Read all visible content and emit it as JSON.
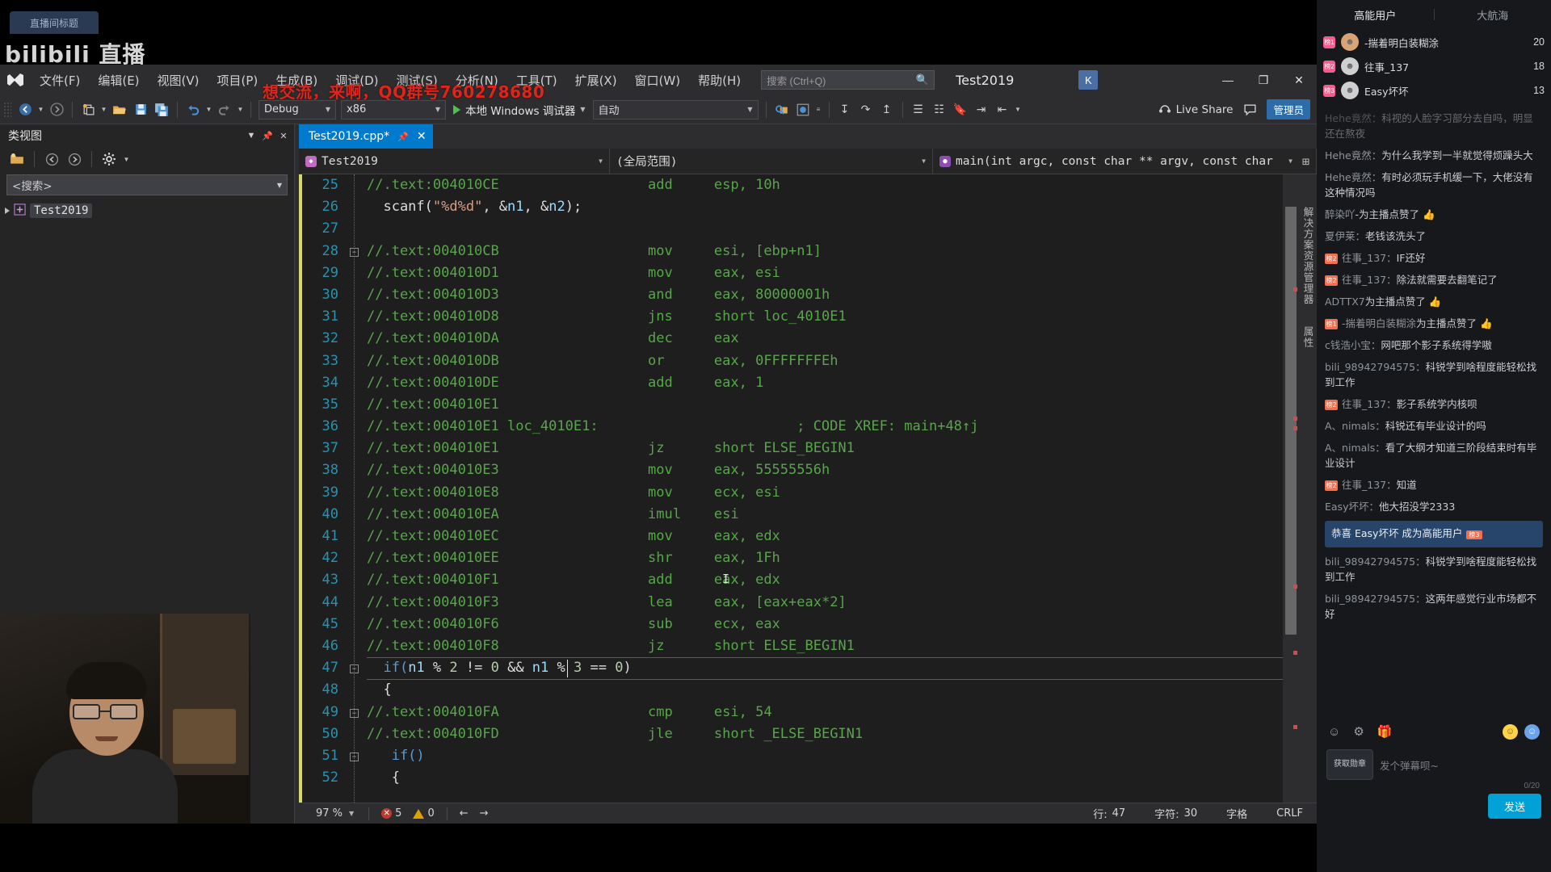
{
  "stream": {
    "tab_label": "直播间标题",
    "logo_text": "bilibili 直播"
  },
  "vs": {
    "window_title": "Test2019",
    "watermark": "想交流，来啊，QQ群号760278680",
    "account_initial": "K",
    "menu": [
      {
        "label": "文件(F)"
      },
      {
        "label": "编辑(E)"
      },
      {
        "label": "视图(V)"
      },
      {
        "label": "项目(P)"
      },
      {
        "label": "生成(B)"
      },
      {
        "label": "调试(D)"
      },
      {
        "label": "测试(S)"
      },
      {
        "label": "分析(N)"
      },
      {
        "label": "工具(T)"
      },
      {
        "label": "扩展(X)"
      },
      {
        "label": "窗口(W)"
      },
      {
        "label": "帮助(H)"
      }
    ],
    "search": {
      "placeholder": "搜索 (Ctrl+Q)",
      "value": "",
      "icon": "magnifier-icon"
    },
    "window_buttons": {
      "minimize": "—",
      "maximize": "❐",
      "close": "✕"
    },
    "toolbar": {
      "nav_back": "back-arrow-icon",
      "nav_forward": "forward-arrow-icon",
      "new_item": "new-file-icon",
      "open": "open-folder-icon",
      "save": "save-icon",
      "save_all": "save-all-icon",
      "undo": "undo-icon",
      "redo": "redo-icon",
      "config": "Debug",
      "platform": "x86",
      "run_label": "本地 Windows 调试器",
      "auto_label": "自动",
      "live_share": "Live Share",
      "admin_badge": "管理员"
    }
  },
  "classview": {
    "title": "类视图",
    "search_placeholder": "<搜索>",
    "tree": [
      {
        "label": "Test2019",
        "icon": "project-icon"
      }
    ],
    "buttons": {
      "new_folder": "new-folder-icon",
      "back": "back-circle-icon",
      "forward": "forward-circle-icon",
      "settings": "gear-icon",
      "dropdown": "chevron-down-icon",
      "pin": "pin-icon",
      "close": "close-icon"
    }
  },
  "editor": {
    "tab": {
      "label": "Test2019.cpp*",
      "pin": "pin-icon",
      "close": "close-icon"
    },
    "nav": {
      "project": "Test2019",
      "scope": "(全局范围)",
      "member": "main(int argc, const char ** argv, const char"
    },
    "first_line_number": 25,
    "lines": [
      {
        "n": 25,
        "type": "asm",
        "addr": "//.text:004010CE",
        "mn": "add",
        "op": "esp, 10h",
        "fold": false
      },
      {
        "n": 26,
        "type": "cpp",
        "segments": [
          {
            "t": "  scanf(",
            "c": "pln"
          },
          {
            "t": "\"%d%d\"",
            "c": "str"
          },
          {
            "t": ", &",
            "c": "pln"
          },
          {
            "t": "n1",
            "c": "mac"
          },
          {
            "t": ", &",
            "c": "pln"
          },
          {
            "t": "n2",
            "c": "mac"
          },
          {
            "t": ");",
            "c": "pln"
          }
        ]
      },
      {
        "n": 27,
        "type": "blank"
      },
      {
        "n": 28,
        "type": "asm",
        "addr": "//.text:004010CB",
        "mn": "mov",
        "op": "esi, [ebp+n1]",
        "fold": true
      },
      {
        "n": 29,
        "type": "asm",
        "addr": "//.text:004010D1",
        "mn": "mov",
        "op": "eax, esi",
        "fold": false
      },
      {
        "n": 30,
        "type": "asm",
        "addr": "//.text:004010D3",
        "mn": "and",
        "op": "eax, 80000001h",
        "fold": false
      },
      {
        "n": 31,
        "type": "asm",
        "addr": "//.text:004010D8",
        "mn": "jns",
        "op": "short loc_4010E1",
        "fold": false
      },
      {
        "n": 32,
        "type": "asm",
        "addr": "//.text:004010DA",
        "mn": "dec",
        "op": "eax",
        "fold": false
      },
      {
        "n": 33,
        "type": "asm",
        "addr": "//.text:004010DB",
        "mn": "or",
        "op": "eax, 0FFFFFFFEh",
        "fold": false
      },
      {
        "n": 34,
        "type": "asm",
        "addr": "//.text:004010DE",
        "mn": "add",
        "op": "eax, 1",
        "fold": false
      },
      {
        "n": 35,
        "type": "asm",
        "addr": "//.text:004010E1",
        "mn": "",
        "op": "",
        "fold": false
      },
      {
        "n": 36,
        "type": "asmlabel",
        "addr": "//.text:004010E1 loc_4010E1:",
        "comment": "; CODE XREF: main+48↑j",
        "fold": false
      },
      {
        "n": 37,
        "type": "asm",
        "addr": "//.text:004010E1",
        "mn": "jz",
        "op": "short ELSE_BEGIN1",
        "fold": false
      },
      {
        "n": 38,
        "type": "asm",
        "addr": "//.text:004010E3",
        "mn": "mov",
        "op": "eax, 55555556h",
        "fold": false
      },
      {
        "n": 39,
        "type": "asm",
        "addr": "//.text:004010E8",
        "mn": "mov",
        "op": "ecx, esi",
        "fold": false
      },
      {
        "n": 40,
        "type": "asm",
        "addr": "//.text:004010EA",
        "mn": "imul",
        "op": "esi",
        "fold": false
      },
      {
        "n": 41,
        "type": "asm",
        "addr": "//.text:004010EC",
        "mn": "mov",
        "op": "eax, edx",
        "fold": false
      },
      {
        "n": 42,
        "type": "asm",
        "addr": "//.text:004010EE",
        "mn": "shr",
        "op": "eax, 1Fh",
        "fold": false
      },
      {
        "n": 43,
        "type": "asm",
        "addr": "//.text:004010F1",
        "mn": "add",
        "op": "eax, edx",
        "fold": false
      },
      {
        "n": 44,
        "type": "asm",
        "addr": "//.text:004010F3",
        "mn": "lea",
        "op": "eax, [eax+eax*2]",
        "fold": false
      },
      {
        "n": 45,
        "type": "asm",
        "addr": "//.text:004010F6",
        "mn": "sub",
        "op": "ecx, eax",
        "fold": false
      },
      {
        "n": 46,
        "type": "asm",
        "addr": "//.text:004010F8",
        "mn": "jz",
        "op": "short ELSE_BEGIN1",
        "fold": false
      },
      {
        "n": 47,
        "type": "cpp",
        "current": true,
        "fold": true,
        "segments": [
          {
            "t": "  if(",
            "c": "kw"
          },
          {
            "t": "n1",
            "c": "mac"
          },
          {
            "t": " % ",
            "c": "pln"
          },
          {
            "t": "2",
            "c": "num"
          },
          {
            "t": " != ",
            "c": "pln"
          },
          {
            "t": "0",
            "c": "num"
          },
          {
            "t": " && ",
            "c": "pln"
          },
          {
            "t": "n1",
            "c": "mac"
          },
          {
            "t": " % ",
            "c": "pln"
          },
          {
            "t": "3",
            "c": "num"
          },
          {
            "t": " == ",
            "c": "pln"
          },
          {
            "t": "0",
            "c": "num"
          },
          {
            "t": ")",
            "c": "pln"
          }
        ]
      },
      {
        "n": 48,
        "type": "cpp",
        "segments": [
          {
            "t": "  {",
            "c": "pln"
          }
        ]
      },
      {
        "n": 49,
        "type": "asm",
        "addr": "//.text:004010FA",
        "mn": "cmp",
        "op": "esi, 54",
        "fold": true
      },
      {
        "n": 50,
        "type": "asm",
        "addr": "//.text:004010FD",
        "mn": "jle",
        "op": "short _ELSE_BEGIN1",
        "fold": false
      },
      {
        "n": 51,
        "type": "cpp",
        "fold": true,
        "segments": [
          {
            "t": "   if()",
            "c": "kw"
          }
        ]
      },
      {
        "n": 52,
        "type": "cpp",
        "segments": [
          {
            "t": "   {",
            "c": "pln"
          }
        ]
      }
    ],
    "rail_labels": [
      "解决方案资源管理器",
      "属性"
    ]
  },
  "statusbar": {
    "zoom": "97 %",
    "errors": "5",
    "warnings": "0",
    "line_label": "行:",
    "line_value": "47",
    "col_label": "字符:",
    "col_value": "30",
    "spaces": "字格",
    "eol": "CRLF",
    "back_icon": "arrow-left-icon",
    "forward_icon": "arrow-right-icon"
  },
  "chat": {
    "tabs": [
      {
        "label": "高能用户",
        "active": true
      },
      {
        "label": "大航海",
        "active": false
      }
    ],
    "ranking": [
      {
        "rank": "榜1",
        "name": "-揣着明白装糊涂",
        "value": "20"
      },
      {
        "rank": "榜2",
        "name": "往事_137",
        "value": "18"
      },
      {
        "rank": "榜3",
        "name": "Easy坏坏",
        "value": "13"
      }
    ],
    "messages": [
      {
        "user": "Hehe竟然",
        "text": "科视的人脸字习部分去自吗，明显还在熬夜",
        "faded": true
      },
      {
        "user": "Hehe竟然",
        "text": "为什么我学到一半就觉得烦躁头大"
      },
      {
        "user": "Hehe竟然",
        "text": "有时必须玩手机缓一下，大佬没有这种情况吗"
      },
      {
        "user": "醉染吖",
        "action": "-为主播点赞了",
        "thumb": true
      },
      {
        "user": "夏伊莱",
        "text": "老钱该洗头了"
      },
      {
        "level": "榜2",
        "user": "往事_137",
        "text": "IF还好"
      },
      {
        "level": "榜2",
        "user": "往事_137",
        "text": "除法就需要去翻笔记了"
      },
      {
        "user": "ADTTX7",
        "action": "为主播点赞了",
        "thumb": true
      },
      {
        "level": "榜1",
        "user": "-揣着明白装糊涂",
        "action": "为主播点赞了",
        "thumb": true
      },
      {
        "user": "c钱浩小宝",
        "text": "网吧那个影子系统得学嗷"
      },
      {
        "user": "bili_98942794575",
        "text": "科锐学到啥程度能轻松找到工作"
      },
      {
        "level": "榜2",
        "user": "往事_137",
        "text": "影子系统学内核呗"
      },
      {
        "user": "A、nimals",
        "text": "科锐还有毕业设计的吗"
      },
      {
        "user": "A、nimals",
        "text": "看了大纲才知道三阶段结束时有毕业设计"
      },
      {
        "level": "榜2",
        "user": "往事_137",
        "text": "知道"
      },
      {
        "user": "Easy坏坏",
        "text": "他大招没学2333"
      },
      {
        "highlight": "恭喜 Easy坏坏 成为高能用户",
        "badge": "榜3"
      },
      {
        "user": "bili_98942794575",
        "text": "科锐学到啥程度能轻松找到工作"
      },
      {
        "user": "bili_98942794575",
        "text": "这两年感觉行业市场都不好"
      }
    ],
    "input_placeholder": "发个弹幕呗~",
    "gift_button": "获取勋章",
    "char_count": "0/20",
    "send_label": "发送",
    "icons": [
      "emoji-icon",
      "lottery-icon",
      "gift-icon"
    ],
    "colors": {
      "send": "#00a1d6",
      "highlight": "#27456b",
      "badge": "#f2704f"
    }
  }
}
